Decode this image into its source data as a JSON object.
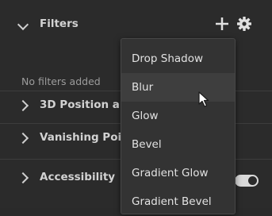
{
  "filters": {
    "title": "Filters",
    "empty_text": "No filters added",
    "add_icon": "plus-icon",
    "settings_icon": "gear-icon"
  },
  "sections": [
    {
      "label": "3D Position an"
    },
    {
      "label": "Vanishing Poin"
    },
    {
      "label": "Accessibility",
      "toggle": "on"
    }
  ],
  "menu": {
    "items": [
      "Drop Shadow",
      "Blur",
      "Glow",
      "Bevel",
      "Gradient Glow",
      "Gradient Bevel"
    ],
    "hovered": "Blur"
  },
  "colors": {
    "panel_bg": "#2b2b2b",
    "menu_bg": "#333333",
    "hover_bg": "#3e3e3e",
    "text": "#d2d2d2"
  }
}
